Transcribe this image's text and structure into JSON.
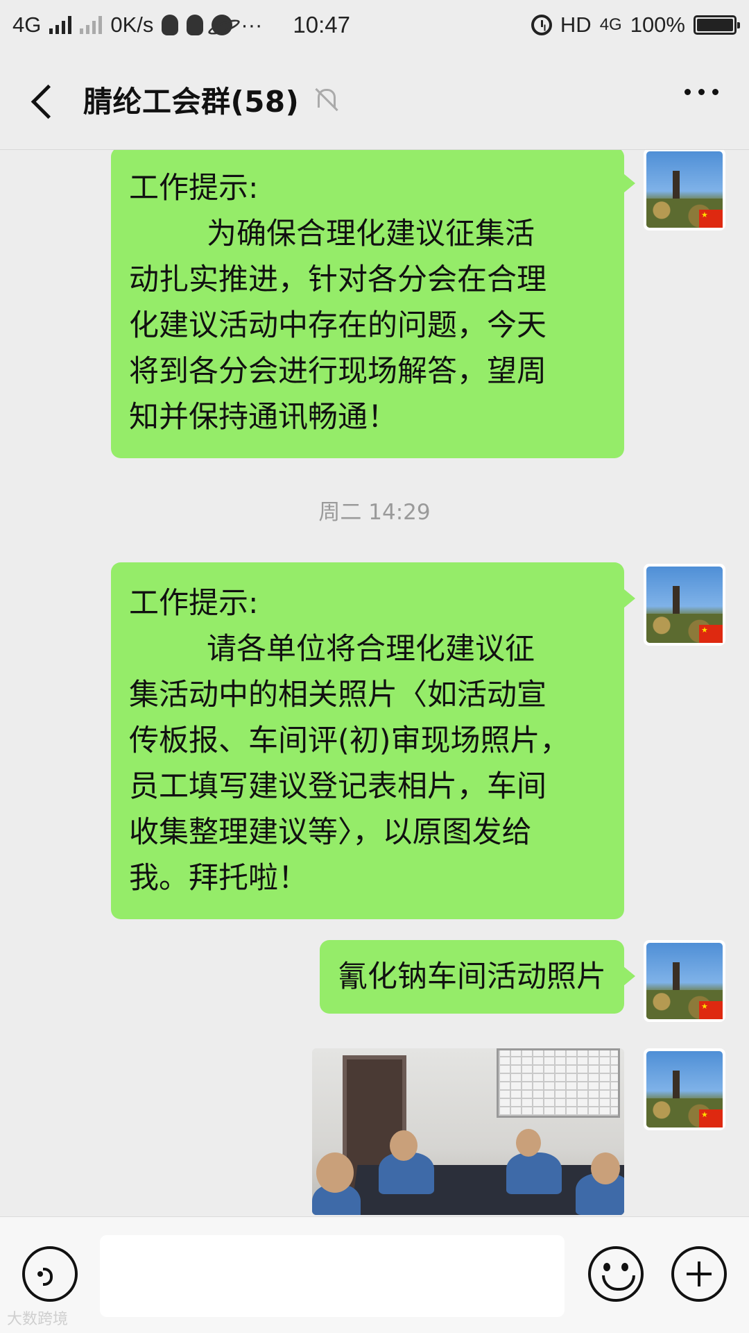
{
  "status_bar": {
    "network_left": "4G",
    "speed": "0K/s",
    "more": "···",
    "time": "10:47",
    "hd": "HD",
    "network_right": "4G",
    "battery": "100%"
  },
  "header": {
    "title": "腈纶工会群(58)"
  },
  "messages": [
    {
      "type": "text",
      "lines": [
        "工作提示:",
        "为确保合理化建议征集活",
        "动扎实推进，针对各分会在合理",
        "化建议活动中存在的问题，今天",
        "将到各分会进行现场解答，望周",
        "知并保持通讯畅通！"
      ]
    },
    {
      "type": "timestamp",
      "text": "周二 14:29"
    },
    {
      "type": "text",
      "lines": [
        "工作提示:",
        "请各单位将合理化建议征",
        "集活动中的相关照片〈如活动宣",
        "传板报、车间评(初)审现场照片，",
        "员工填写建议登记表相片，车间",
        "收集整理建议等〉，以原图发给",
        "我。拜托啦！"
      ]
    },
    {
      "type": "text",
      "lines": [
        "氰化钠车间活动照片"
      ]
    },
    {
      "type": "image"
    }
  ],
  "avatar_flag_icon": "china-flag-icon",
  "watermark": "大数跨境",
  "colors": {
    "bubble": "#95ec69",
    "background": "#ededed"
  }
}
